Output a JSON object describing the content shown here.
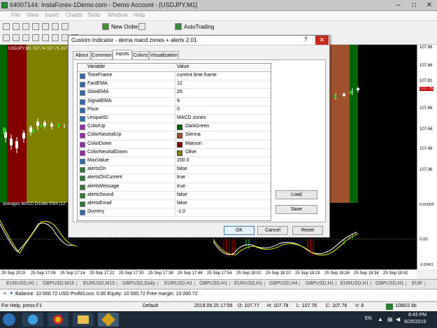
{
  "window": {
    "title": "64007144: InstaForex-1Demo.com - Demo Account - [USDJPY,M1]"
  },
  "menu": [
    "File",
    "View",
    "Insert",
    "Charts",
    "Tools",
    "Window",
    "Help"
  ],
  "toolbar": {
    "new_order": "New Order",
    "autotrading": "AutoTrading"
  },
  "chart": {
    "label": "USDJPY,M1  107.74 107.75 107.75 107.75",
    "indicator_label": "averages MACD Double EMA (12,",
    "price_ticks": [
      "107.96",
      "107.86",
      "107.81",
      "107.75",
      "107.66",
      "107.56",
      "107.46",
      "107.36"
    ],
    "price_highlight": "107.75",
    "indicator_ticks": [
      "0.031925",
      "0.00",
      "-0.02401"
    ],
    "time_ticks": [
      "25 Sep 2019",
      "25 Sep 17:06",
      "25 Sep 17:14",
      "25 Sep 17:22",
      "25 Sep 17:30",
      "25 Sep 17:38",
      "25 Sep 17:46",
      "25 Sep 17:54",
      "25 Sep 18:02",
      "25 Sep 18:10",
      "25 Sep 18:18",
      "25 Sep 18:26",
      "25 Sep 18:34",
      "25 Sep 18:42"
    ],
    "colors": {
      "dark_green": "#006400",
      "sienna": "#a0522d",
      "maroon": "#800000",
      "olive": "#808000"
    }
  },
  "symbol_tabs": [
    "EURUSD,H1",
    "GBPUSD,M15",
    "EURUSD,M15",
    "GBPUSD,Daily",
    "EURUSD,H1",
    "GBPUSD,H1",
    "EURUSD,H1",
    "GBPUSD,H4",
    "GBPUSD,H1",
    "EURUSD,H1",
    "GBPUSD,H1",
    "EUR"
  ],
  "balance": "Balance: 10 000.72 USD  Profit/Loss: 0.00  Equity: 10 000.72  Free margin: 10 000.72",
  "status": {
    "help": "For Help, press F1",
    "profile": "Default",
    "datetime": "2019.09.25 17:56",
    "open": "O: 107.77",
    "high": "H: 107.78",
    "low": "L: 107.76",
    "close": "C: 107.76",
    "volume": "V: 8",
    "traffic": "1080/2 kb"
  },
  "taskbar": {
    "lang": "EN",
    "time": "8:43 PM",
    "date": "9/25/2019"
  },
  "dialog": {
    "title": "Custom Indicator - dema macd zones + alerts 2.01",
    "help": "?",
    "close": "✕",
    "tabs": [
      "About",
      "Common",
      "Inputs",
      "Colors",
      "Visualization"
    ],
    "active_tab": "Inputs",
    "columns": [
      "Variable",
      "Value"
    ],
    "params": [
      {
        "icon": "Ab",
        "name": "TimeFrame",
        "value": "current time frame"
      },
      {
        "icon": "123",
        "name": "FastEMA",
        "value": "12"
      },
      {
        "icon": "123",
        "name": "SlowEMA",
        "value": "26"
      },
      {
        "icon": "123",
        "name": "SignalEMA",
        "value": "9"
      },
      {
        "icon": "123",
        "name": "Price",
        "value": "0"
      },
      {
        "icon": "ab",
        "name": "UniqueID",
        "value": "MACD zones"
      },
      {
        "icon": "col",
        "name": "ColorUp",
        "value": "DarkGreen",
        "swatch": "#006400"
      },
      {
        "icon": "col",
        "name": "ColorNeutralUp",
        "value": "Sienna",
        "swatch": "#a0522d"
      },
      {
        "icon": "col",
        "name": "ColorDown",
        "value": "Maroon",
        "swatch": "#800000"
      },
      {
        "icon": "col",
        "name": "ColorNeutralDown",
        "value": "Olive",
        "swatch": "#808000"
      },
      {
        "icon": "v2",
        "name": "MaxValue",
        "value": "200.0"
      },
      {
        "icon": "bool",
        "name": "alertsOn",
        "value": "false"
      },
      {
        "icon": "bool",
        "name": "alertsOnCurrent",
        "value": "true"
      },
      {
        "icon": "bool",
        "name": "alertsMessage",
        "value": "true"
      },
      {
        "icon": "bool",
        "name": "alertsSound",
        "value": "false"
      },
      {
        "icon": "bool",
        "name": "alertsEmail",
        "value": "false"
      },
      {
        "icon": "v2",
        "name": "Dummy",
        "value": "-1.0"
      }
    ],
    "load": "Load",
    "save": "Save",
    "ok": "OK",
    "cancel": "Cancel",
    "reset": "Reset"
  }
}
